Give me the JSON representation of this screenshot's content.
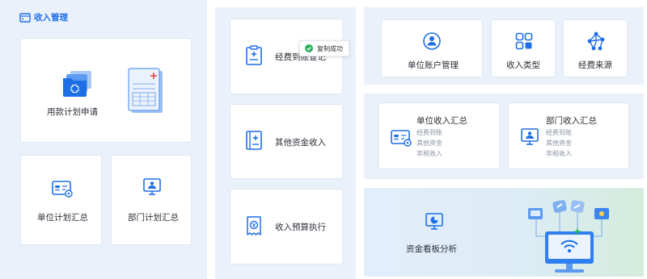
{
  "section_title": "收入管理",
  "left": {
    "apply": "用款计划申请",
    "unit_plan": "单位计划汇总",
    "dept_plan": "部门计划汇总"
  },
  "middle": {
    "fee_register": "经费到账登记",
    "other_income": "其他资金收入",
    "budget_exec": "收入预算执行"
  },
  "toast": {
    "text": "复制成功"
  },
  "right": {
    "unit_account": "单位账户管理",
    "income_type": "收入类型",
    "fund_source": "经费来源",
    "unit_summary": {
      "title": "单位收入汇总",
      "items": [
        "经费到账",
        "其他资金",
        "非税收入"
      ]
    },
    "dept_summary": {
      "title": "部门收入汇总",
      "items": [
        "经费到账",
        "其他资金",
        "非税收入"
      ]
    },
    "dashboard": "资金看板分析"
  },
  "colors": {
    "accent": "#1e6fe6",
    "panel": "#eaf1fb",
    "card_border": "#dfe7f3",
    "success": "#24b35a"
  }
}
